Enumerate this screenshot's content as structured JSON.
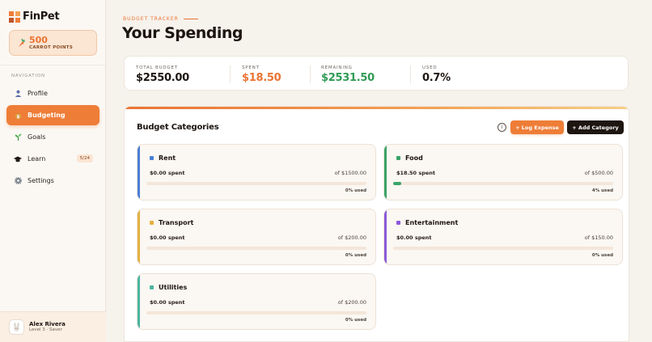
{
  "app": {
    "name": "FinPet"
  },
  "points": {
    "value": "500",
    "label": "CARROT POINTS"
  },
  "nav": {
    "heading": "NAVIGATION",
    "items": [
      {
        "label": "Profile",
        "icon": "person-icon"
      },
      {
        "label": "Budgeting",
        "icon": "money-bag-icon",
        "active": true
      },
      {
        "label": "Goals",
        "icon": "seedling-icon"
      },
      {
        "label": "Learn",
        "icon": "graduation-cap-icon",
        "badge": "5/24"
      },
      {
        "label": "Settings",
        "icon": "gear-icon"
      }
    ]
  },
  "user": {
    "name": "Alex Rivera",
    "level": "Level 3 · Saver",
    "avatar": "bunny-icon"
  },
  "header": {
    "eyebrow": "BUDGET TRACKER",
    "title": "Your Spending"
  },
  "stats": {
    "total_budget": {
      "label": "TOTAL BUDGET",
      "value": "$2550.00"
    },
    "spent": {
      "label": "SPENT",
      "value": "$18.50"
    },
    "remaining": {
      "label": "REMAINING",
      "value": "$2531.50"
    },
    "used": {
      "label": "USED",
      "value": "0.7%"
    }
  },
  "panel": {
    "title": "Budget Categories",
    "info_icon": "i",
    "log_button": "+ Log Expense",
    "add_button": "+ Add Category"
  },
  "categories": [
    {
      "name": "Rent",
      "spent": "$0.00 spent",
      "budget": "of $1500.00",
      "used": "0% used",
      "fraction": 0.0,
      "color": "#4a7fd6"
    },
    {
      "name": "Food",
      "spent": "$18.50 spent",
      "budget": "of $500.00",
      "used": "4% used",
      "fraction": 0.037,
      "color": "#3aa367"
    },
    {
      "name": "Transport",
      "spent": "$0.00 spent",
      "budget": "of $200.00",
      "used": "0% used",
      "fraction": 0.0,
      "color": "#e6b042"
    },
    {
      "name": "Entertainment",
      "spent": "$0.00 spent",
      "budget": "of $150.00",
      "used": "0% used",
      "fraction": 0.0,
      "color": "#8b5ad9"
    },
    {
      "name": "Utilities",
      "spent": "$0.00 spent",
      "budget": "of $200.00",
      "used": "0% used",
      "fraction": 0.0,
      "color": "#4cb4a0"
    }
  ],
  "colors": {
    "accent": "#ee7d37",
    "spent_value": "#ea7433",
    "remaining_value": "#2f9b55",
    "dark": "#1d1510"
  }
}
